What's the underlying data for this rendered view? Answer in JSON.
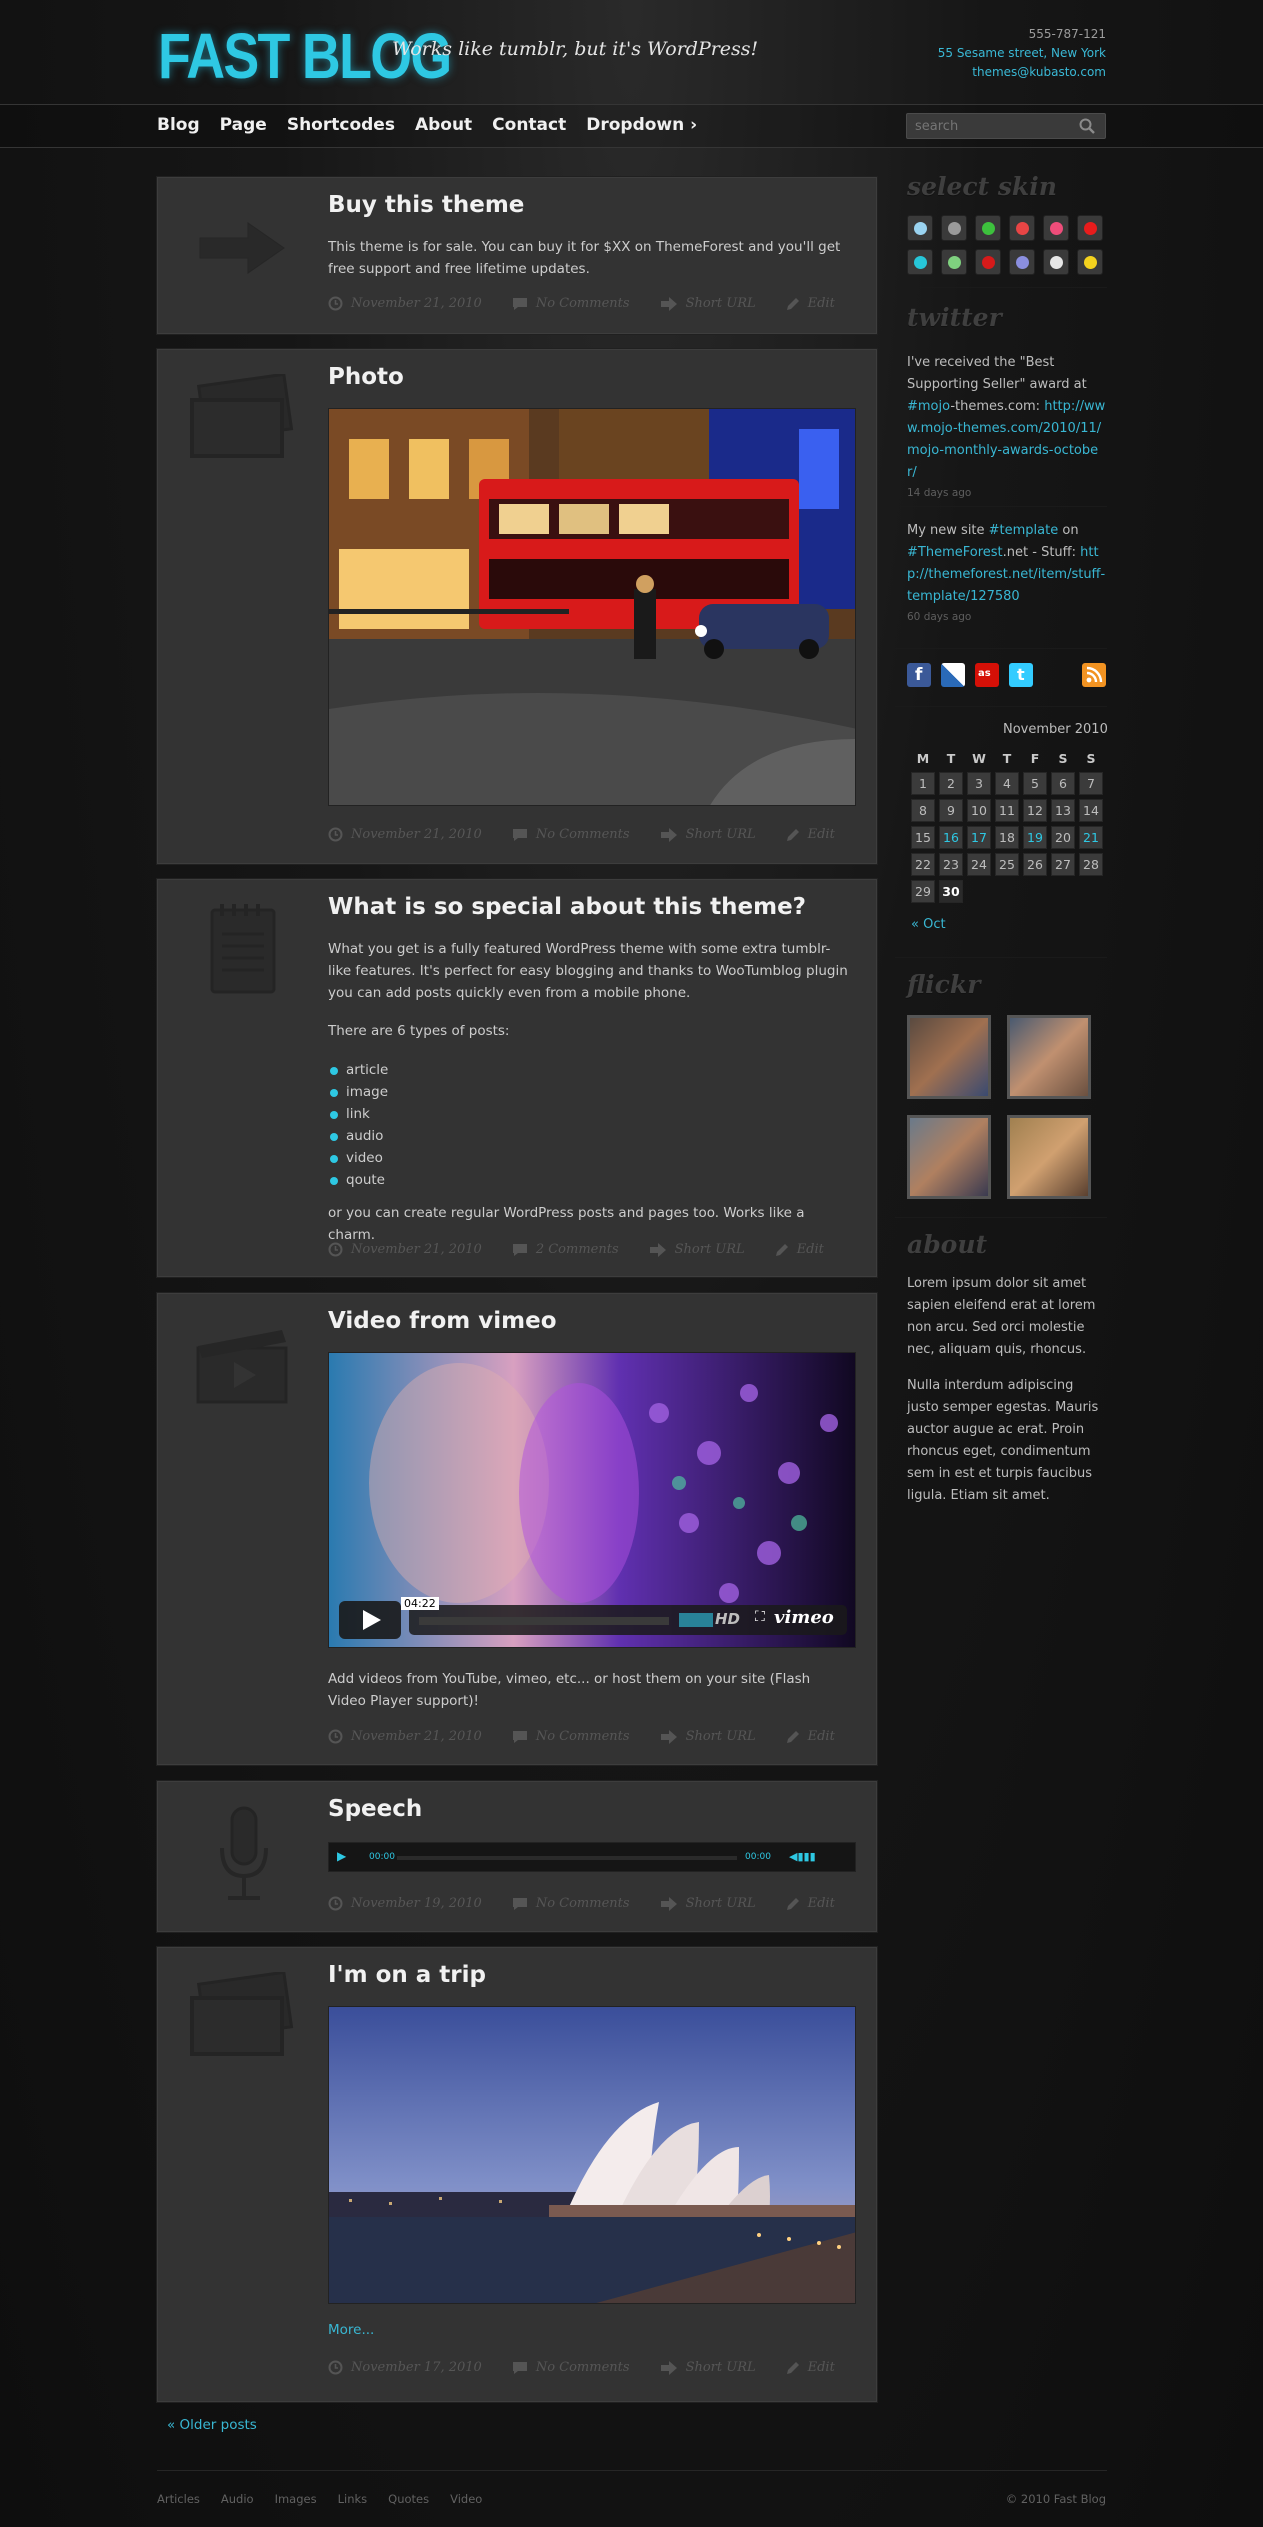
{
  "header": {
    "logo": "FAST BLOG",
    "tagline": "Works like tumblr, but it's WordPress!",
    "phone": "555-787-121",
    "address": "55 Sesame street, New York",
    "email": "themes@kubasto.com"
  },
  "nav": [
    "Blog",
    "Page",
    "Shortcodes",
    "About",
    "Contact",
    "Dropdown ›"
  ],
  "search": {
    "placeholder": "search"
  },
  "posts": [
    {
      "title": "Buy this theme",
      "text": "This theme is for sale. You can buy it for $XX on ThemeForest and you'll get free support and free lifetime updates.",
      "date": "November 21, 2010",
      "comments": "No Comments",
      "short": "Short URL",
      "edit": "Edit",
      "icon": "arrow-icon"
    },
    {
      "title": "Photo",
      "date": "November 21, 2010",
      "comments": "No Comments",
      "short": "Short URL",
      "edit": "Edit",
      "icon": "photo-icon"
    },
    {
      "title": "What is so special about this theme?",
      "p1": "What you get is a fully featured WordPress theme with some extra tumblr-like features. It's perfect for easy blogging and thanks to WooTumblog plugin you can add posts quickly even from a mobile phone.",
      "p2": "There are 6 types of posts:",
      "types": [
        "article",
        "image",
        "link",
        "audio",
        "video",
        "qoute"
      ],
      "p3": "or you can create regular WordPress posts and pages too. Works like a charm.",
      "date": "November 21, 2010",
      "comments": "2 Comments",
      "short": "Short URL",
      "edit": "Edit",
      "icon": "notepad-icon"
    },
    {
      "title": "Video from vimeo",
      "time": "04:22",
      "hd": "HD",
      "vimeo": "vimeo",
      "text": "Add videos from YouTube, vimeo, etc... or host them on your site (Flash Video Player support)!",
      "date": "November 21, 2010",
      "comments": "No Comments",
      "short": "Short URL",
      "edit": "Edit",
      "icon": "clapper-icon"
    },
    {
      "title": "Speech",
      "t1": "00:00",
      "t2": "00:00",
      "date": "November 19, 2010",
      "comments": "No Comments",
      "short": "Short URL",
      "edit": "Edit",
      "icon": "microphone-icon"
    },
    {
      "title": "I'm on a trip",
      "more": "More...",
      "date": "November 17, 2010",
      "comments": "No Comments",
      "short": "Short URL",
      "edit": "Edit",
      "icon": "photo-icon"
    }
  ],
  "sidebar": {
    "skin_title": "select skin",
    "skins": [
      "#9ad3f0",
      "#9a9a9a",
      "#3dc13d",
      "#e84545",
      "#ee4d7a",
      "#e81c1c",
      "#27c6d8",
      "#7fd17f",
      "#d61a1a",
      "#8b8fe0",
      "#e6e6e6",
      "#f4d21e"
    ],
    "twitter_title": "twitter",
    "tweets": [
      {
        "pre": "I've received the \"Best Supporting Seller\" award at ",
        "tag": "#mojo",
        "mid": "-themes.com: ",
        "link": "http://www.mojo-themes.com/2010/11/mojo-monthly-awards-october/",
        "ago": "14 days ago"
      },
      {
        "pre": "My new site ",
        "tag": "#template",
        "mid": " on ",
        "tag2": "#ThemeForest",
        "mid2": ".net - Stuff: ",
        "link": "http://themeforest.net/item/stuff-template/127580",
        "ago": "60 days ago"
      }
    ],
    "calendar": {
      "caption": "November 2010",
      "days": [
        "M",
        "T",
        "W",
        "T",
        "F",
        "S",
        "S"
      ],
      "prev": "« Oct",
      "weeks": [
        [
          "1",
          "2",
          "3",
          "4",
          "5",
          "6",
          "7"
        ],
        [
          "8",
          "9",
          "10",
          "11",
          "12",
          "13",
          "14"
        ],
        [
          "15",
          "16",
          "17",
          "18",
          "19",
          "20",
          "21"
        ],
        [
          "22",
          "23",
          "24",
          "25",
          "26",
          "27",
          "28"
        ],
        [
          "29",
          "30",
          "",
          "",
          "",
          "",
          ""
        ]
      ],
      "linked": [
        "16",
        "17",
        "19",
        "21"
      ],
      "today": "30"
    },
    "flickr_title": "flickr",
    "about_title": "about",
    "about_p1": "Lorem ipsum dolor sit amet sapien eleifend erat at lorem non arcu. Sed orci molestie nec, aliquam quis, rhoncus.",
    "about_p2": "Nulla interdum adipiscing justo semper egestas. Mauris auctor augue ac erat. Proin rhoncus eget, condimentum sem in est et turpis faucibus ligula. Etiam sit amet."
  },
  "older": "« Older posts",
  "footer": {
    "links": [
      "Articles",
      "Audio",
      "Images",
      "Links",
      "Quotes",
      "Video"
    ],
    "copyright": "© 2010 Fast Blog"
  },
  "colors": {
    "accent": "#2ec8e3",
    "panel": "#333333",
    "background": "#111111"
  }
}
